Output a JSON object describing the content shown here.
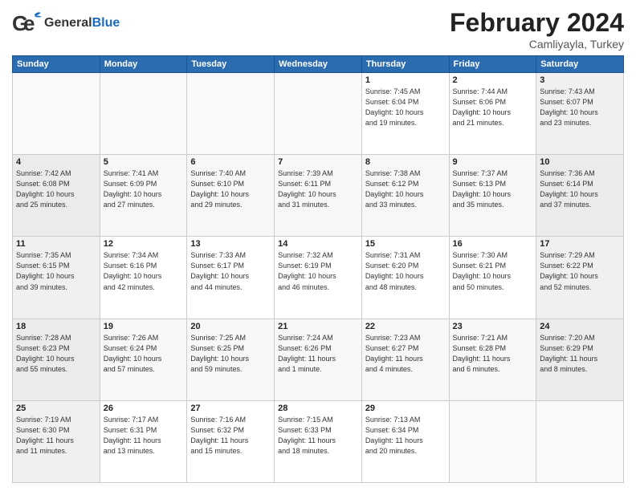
{
  "header": {
    "logo_general": "General",
    "logo_blue": "Blue",
    "month_title": "February 2024",
    "location": "Camliyayla, Turkey"
  },
  "days_of_week": [
    "Sunday",
    "Monday",
    "Tuesday",
    "Wednesday",
    "Thursday",
    "Friday",
    "Saturday"
  ],
  "weeks": [
    [
      {
        "day": "",
        "info": ""
      },
      {
        "day": "",
        "info": ""
      },
      {
        "day": "",
        "info": ""
      },
      {
        "day": "",
        "info": ""
      },
      {
        "day": "1",
        "info": "Sunrise: 7:45 AM\nSunset: 6:04 PM\nDaylight: 10 hours\nand 19 minutes."
      },
      {
        "day": "2",
        "info": "Sunrise: 7:44 AM\nSunset: 6:06 PM\nDaylight: 10 hours\nand 21 minutes."
      },
      {
        "day": "3",
        "info": "Sunrise: 7:43 AM\nSunset: 6:07 PM\nDaylight: 10 hours\nand 23 minutes."
      }
    ],
    [
      {
        "day": "4",
        "info": "Sunrise: 7:42 AM\nSunset: 6:08 PM\nDaylight: 10 hours\nand 25 minutes."
      },
      {
        "day": "5",
        "info": "Sunrise: 7:41 AM\nSunset: 6:09 PM\nDaylight: 10 hours\nand 27 minutes."
      },
      {
        "day": "6",
        "info": "Sunrise: 7:40 AM\nSunset: 6:10 PM\nDaylight: 10 hours\nand 29 minutes."
      },
      {
        "day": "7",
        "info": "Sunrise: 7:39 AM\nSunset: 6:11 PM\nDaylight: 10 hours\nand 31 minutes."
      },
      {
        "day": "8",
        "info": "Sunrise: 7:38 AM\nSunset: 6:12 PM\nDaylight: 10 hours\nand 33 minutes."
      },
      {
        "day": "9",
        "info": "Sunrise: 7:37 AM\nSunset: 6:13 PM\nDaylight: 10 hours\nand 35 minutes."
      },
      {
        "day": "10",
        "info": "Sunrise: 7:36 AM\nSunset: 6:14 PM\nDaylight: 10 hours\nand 37 minutes."
      }
    ],
    [
      {
        "day": "11",
        "info": "Sunrise: 7:35 AM\nSunset: 6:15 PM\nDaylight: 10 hours\nand 39 minutes."
      },
      {
        "day": "12",
        "info": "Sunrise: 7:34 AM\nSunset: 6:16 PM\nDaylight: 10 hours\nand 42 minutes."
      },
      {
        "day": "13",
        "info": "Sunrise: 7:33 AM\nSunset: 6:17 PM\nDaylight: 10 hours\nand 44 minutes."
      },
      {
        "day": "14",
        "info": "Sunrise: 7:32 AM\nSunset: 6:19 PM\nDaylight: 10 hours\nand 46 minutes."
      },
      {
        "day": "15",
        "info": "Sunrise: 7:31 AM\nSunset: 6:20 PM\nDaylight: 10 hours\nand 48 minutes."
      },
      {
        "day": "16",
        "info": "Sunrise: 7:30 AM\nSunset: 6:21 PM\nDaylight: 10 hours\nand 50 minutes."
      },
      {
        "day": "17",
        "info": "Sunrise: 7:29 AM\nSunset: 6:22 PM\nDaylight: 10 hours\nand 52 minutes."
      }
    ],
    [
      {
        "day": "18",
        "info": "Sunrise: 7:28 AM\nSunset: 6:23 PM\nDaylight: 10 hours\nand 55 minutes."
      },
      {
        "day": "19",
        "info": "Sunrise: 7:26 AM\nSunset: 6:24 PM\nDaylight: 10 hours\nand 57 minutes."
      },
      {
        "day": "20",
        "info": "Sunrise: 7:25 AM\nSunset: 6:25 PM\nDaylight: 10 hours\nand 59 minutes."
      },
      {
        "day": "21",
        "info": "Sunrise: 7:24 AM\nSunset: 6:26 PM\nDaylight: 11 hours\nand 1 minute."
      },
      {
        "day": "22",
        "info": "Sunrise: 7:23 AM\nSunset: 6:27 PM\nDaylight: 11 hours\nand 4 minutes."
      },
      {
        "day": "23",
        "info": "Sunrise: 7:21 AM\nSunset: 6:28 PM\nDaylight: 11 hours\nand 6 minutes."
      },
      {
        "day": "24",
        "info": "Sunrise: 7:20 AM\nSunset: 6:29 PM\nDaylight: 11 hours\nand 8 minutes."
      }
    ],
    [
      {
        "day": "25",
        "info": "Sunrise: 7:19 AM\nSunset: 6:30 PM\nDaylight: 11 hours\nand 11 minutes."
      },
      {
        "day": "26",
        "info": "Sunrise: 7:17 AM\nSunset: 6:31 PM\nDaylight: 11 hours\nand 13 minutes."
      },
      {
        "day": "27",
        "info": "Sunrise: 7:16 AM\nSunset: 6:32 PM\nDaylight: 11 hours\nand 15 minutes."
      },
      {
        "day": "28",
        "info": "Sunrise: 7:15 AM\nSunset: 6:33 PM\nDaylight: 11 hours\nand 18 minutes."
      },
      {
        "day": "29",
        "info": "Sunrise: 7:13 AM\nSunset: 6:34 PM\nDaylight: 11 hours\nand 20 minutes."
      },
      {
        "day": "",
        "info": ""
      },
      {
        "day": "",
        "info": ""
      }
    ]
  ]
}
